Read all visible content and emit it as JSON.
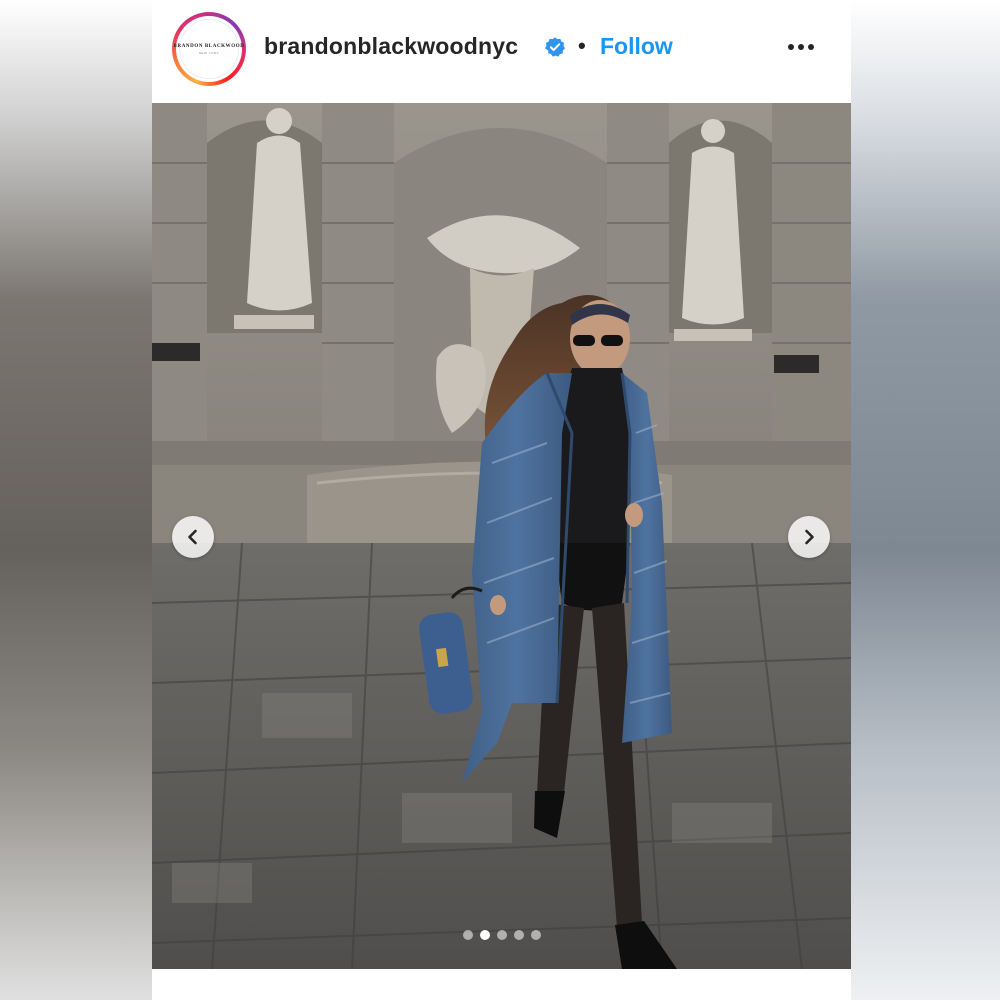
{
  "post": {
    "username": "brandonblackwoodnyc",
    "verified": true,
    "separator": "•",
    "follow_label": "Follow",
    "more_icon": "more-horizontal-icon",
    "avatar_logo": {
      "line1": "BRANDON BLACKWOOD",
      "line2": "NEW YORK"
    }
  },
  "carousel": {
    "slide_count": 5,
    "active_index": 1,
    "prev_icon": "chevron-left-icon",
    "next_icon": "chevron-right-icon"
  },
  "colors": {
    "follow_blue": "#1a95f0",
    "verified_blue": "#2f94f0",
    "text": "#262626"
  }
}
